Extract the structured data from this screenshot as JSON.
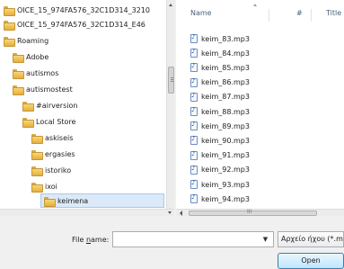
{
  "tree": {
    "items": [
      {
        "label": "OICE_15_974FA576_32C1D314_3210"
      },
      {
        "label": "OICE_15_974FA576_32C1D314_E46"
      },
      {
        "label": "Roaming"
      },
      {
        "label": "Adobe"
      },
      {
        "label": "autismos"
      },
      {
        "label": "autismostest"
      },
      {
        "label": "#airversion"
      },
      {
        "label": "Local Store"
      },
      {
        "label": "askiseis"
      },
      {
        "label": "ergasies"
      },
      {
        "label": "istoriko"
      },
      {
        "label": "ixoi"
      },
      {
        "label": "keimena",
        "selected": true
      },
      {
        "label": "keimena"
      }
    ]
  },
  "files": {
    "columns": {
      "name": "Name",
      "number": "#",
      "title": "Title"
    },
    "items": [
      "keim_83.mp3",
      "keim_84.mp3",
      "keim_85.mp3",
      "keim_86.mp3",
      "keim_87.mp3",
      "keim_88.mp3",
      "keim_89.mp3",
      "keim_90.mp3",
      "keim_91.mp3",
      "keim_92.mp3",
      "keim_93.mp3",
      "keim_94.mp3"
    ],
    "scroll_ellipsis": "III"
  },
  "bottom": {
    "filename_label_prefix": "File ",
    "filename_label_accel": "n",
    "filename_label_suffix": "ame:",
    "filename_value": "",
    "filetype": "Αρχείο ήχου (*.m",
    "open_label": "Open",
    "dropdown_glyph": "▼"
  },
  "icons": {
    "folder": "folder-icon",
    "audio_file": "audio-file-icon"
  },
  "colors": {
    "selection": "#dce9f8",
    "open_button": "#bee6fd",
    "folder": "#e2af3e"
  }
}
